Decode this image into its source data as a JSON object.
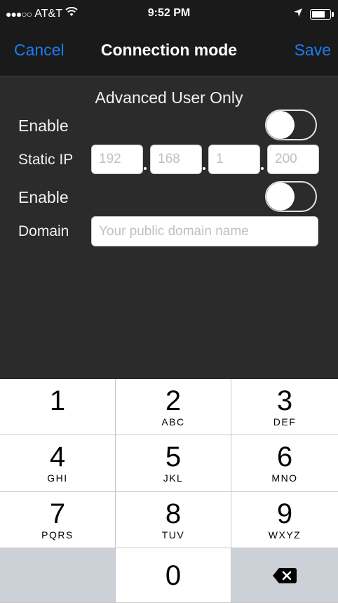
{
  "status_bar": {
    "carrier": "AT&T",
    "signal": "●●●○○",
    "time": "9:52 PM",
    "battery_level": 0.72
  },
  "nav": {
    "cancel_label": "Cancel",
    "title": "Connection mode",
    "save_label": "Save"
  },
  "form": {
    "section_title": "Advanced User Only",
    "enable_static_label": "Enable",
    "static_ip_label": "Static IP",
    "ip_fields": [
      {
        "placeholder": "192"
      },
      {
        "placeholder": "168"
      },
      {
        "placeholder": "1"
      },
      {
        "placeholder": "200"
      }
    ],
    "enable_domain_label": "Enable",
    "domain_label": "Domain",
    "domain_placeholder": "Your public domain name"
  },
  "keypad": {
    "keys": [
      {
        "num": "1",
        "letters": ""
      },
      {
        "num": "2",
        "letters": "ABC"
      },
      {
        "num": "3",
        "letters": "DEF"
      },
      {
        "num": "4",
        "letters": "GHI"
      },
      {
        "num": "5",
        "letters": "JKL"
      },
      {
        "num": "6",
        "letters": "MNO"
      },
      {
        "num": "7",
        "letters": "PQRS"
      },
      {
        "num": "8",
        "letters": "TUV"
      },
      {
        "num": "9",
        "letters": "WXYZ"
      },
      {
        "num": "0",
        "letters": ""
      }
    ]
  },
  "colors": {
    "accent": "#1a7cf5",
    "background": "#2b2b2b",
    "bar": "#1a1a1a",
    "key_gray": "#ccd1d8"
  }
}
